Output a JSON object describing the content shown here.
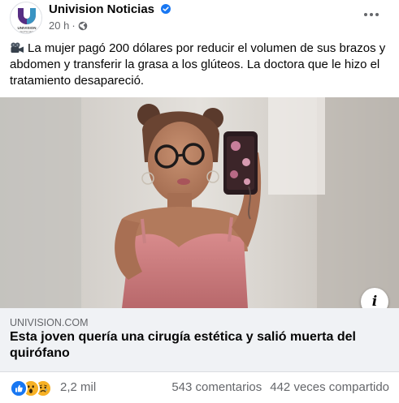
{
  "post": {
    "page_name": "Univision Noticias",
    "avatar_text": "NOTICIAS",
    "time": "20 h",
    "separator": "·",
    "caption": "La mujer pagó 200 dólares por reducir el volumen de sus brazos y abdomen y transferir la grasa a los glúteos. La doctora que le hizo el tratamiento desapareció."
  },
  "link": {
    "domain": "UNIVISION.COM",
    "title": "Esta joven quería una cirugía estética y salió muerta del quirófano",
    "info_label": "i"
  },
  "footer": {
    "reaction_count": "2,2 mil",
    "comments": "543 comentarios",
    "shares": "442 veces compartido"
  },
  "icons": {
    "verified": "verified-badge-icon",
    "globe": "globe-icon",
    "camera": "movie-camera-icon",
    "more": "more-options-icon"
  },
  "colors": {
    "accent": "#1877f2",
    "secondary_text": "#65676b",
    "link_bg": "#f0f2f5"
  }
}
